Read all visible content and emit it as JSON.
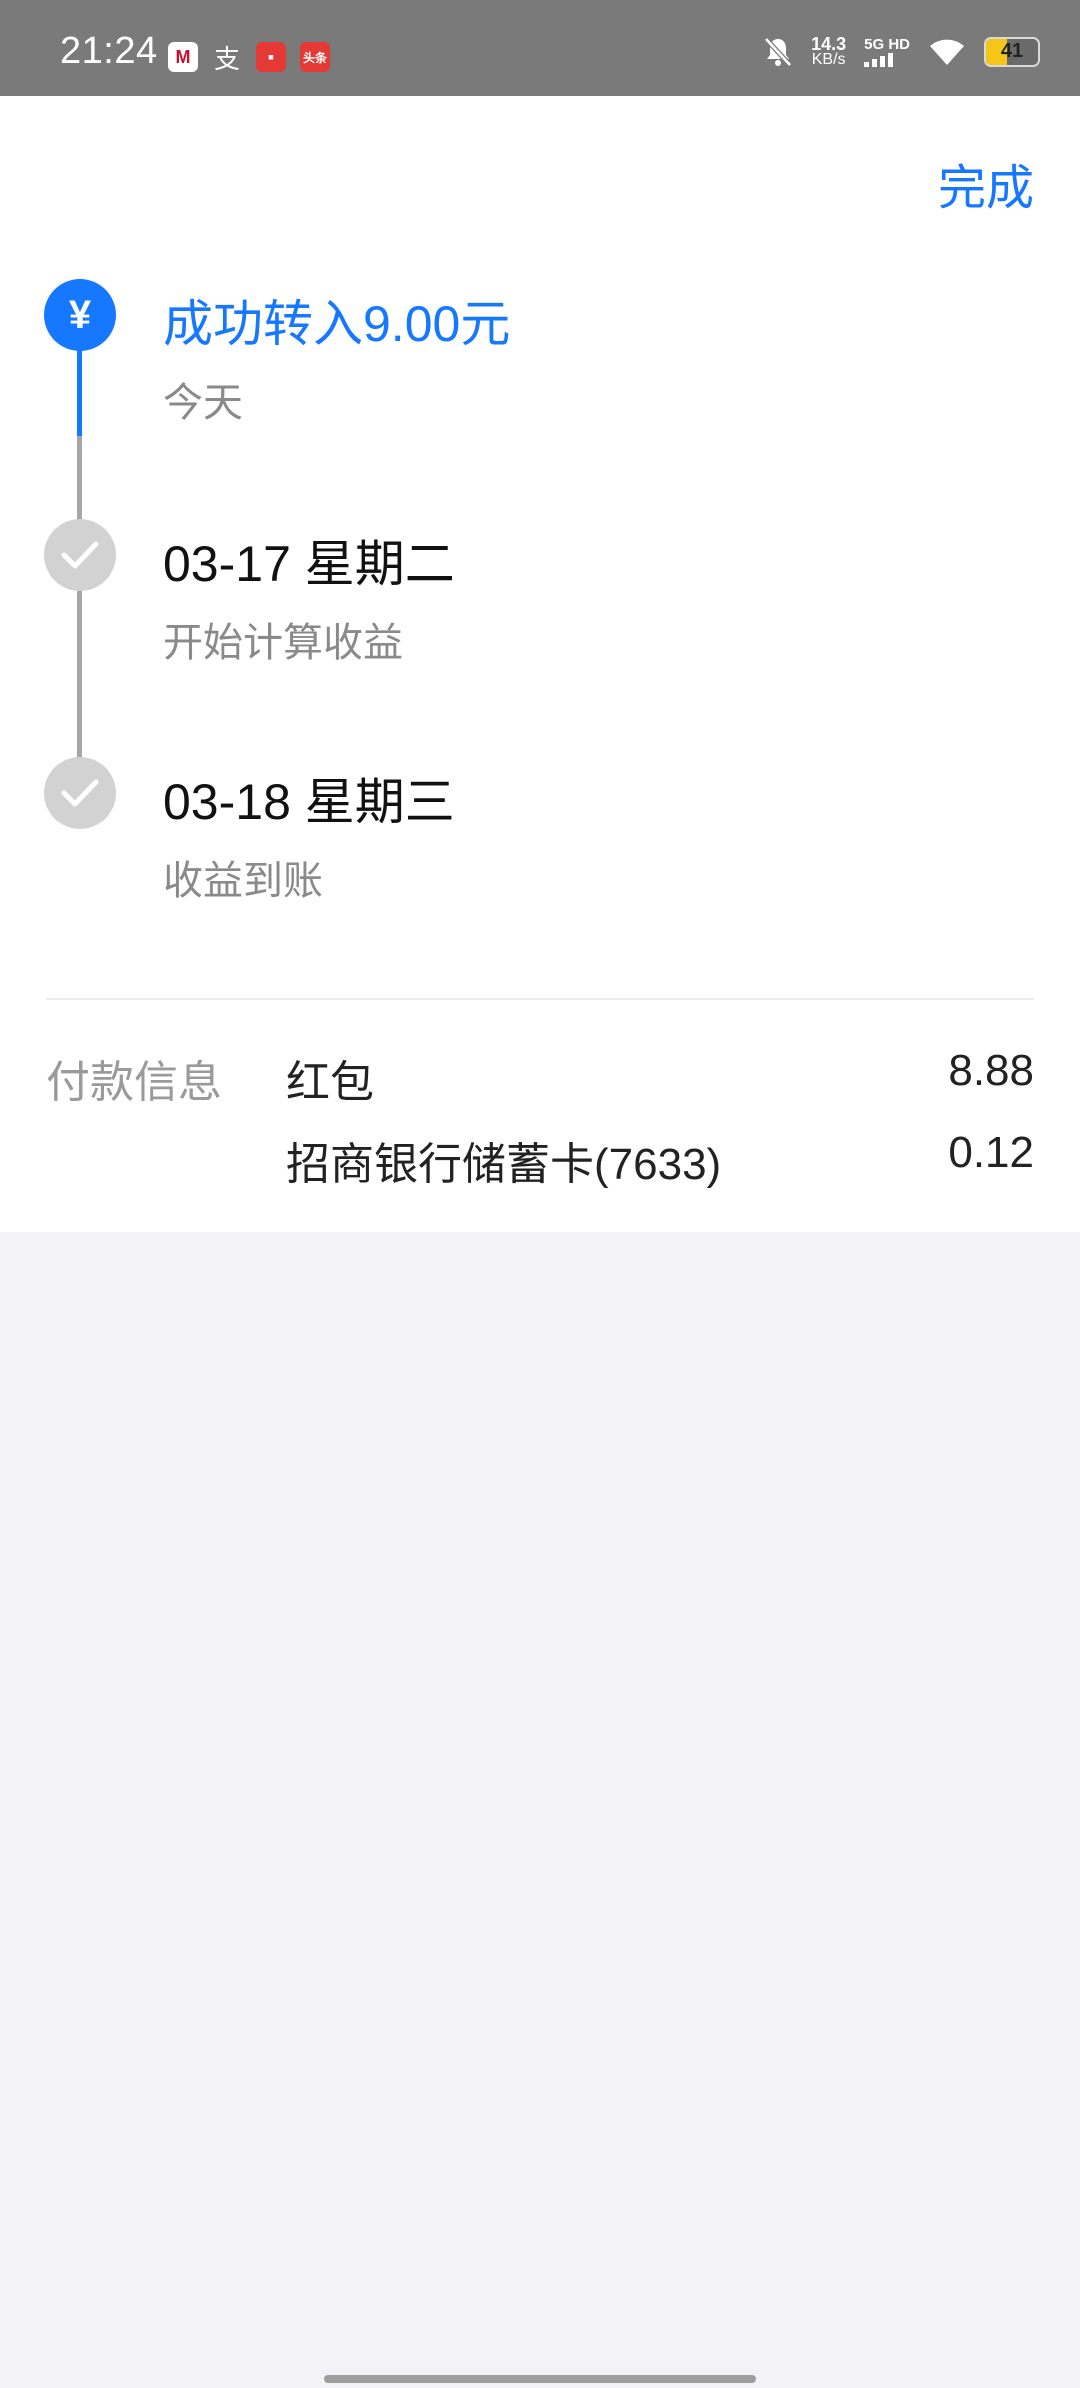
{
  "status_bar": {
    "time": "21:24",
    "notification_icons": [
      "cmb-bank-icon",
      "alipay-icon",
      "app-red-icon",
      "toutiao-icon"
    ],
    "notif_labels": {
      "cmb": "M",
      "alipay": "支",
      "app1": "▪",
      "app2": "头条"
    },
    "net_speed_value": "14.3",
    "net_speed_unit": "KB/s",
    "network_type": "5G HD",
    "battery_level": "41",
    "battery_fraction": 0.41
  },
  "header": {
    "done_label": "完成"
  },
  "timeline": {
    "steps": [
      {
        "title": "成功转入9.00元",
        "subtitle": "今天",
        "state": "current",
        "icon": "yuan-icon",
        "icon_glyph": "¥"
      },
      {
        "title": "03-17 星期二",
        "subtitle": "开始计算收益",
        "state": "upcoming",
        "icon": "check-icon"
      },
      {
        "title": "03-18 星期三",
        "subtitle": "收益到账",
        "state": "upcoming",
        "icon": "check-icon"
      }
    ]
  },
  "payment_info": {
    "label": "付款信息",
    "rows": [
      {
        "name": "红包",
        "amount": "8.88"
      },
      {
        "name": "招商银行储蓄卡(7633)",
        "amount": "0.12"
      }
    ]
  },
  "colors": {
    "accent": "#1677ff",
    "status_bar_bg": "#7a7a7a",
    "page_bg": "#f3f3f7",
    "inactive_node": "#d2d2d2"
  }
}
